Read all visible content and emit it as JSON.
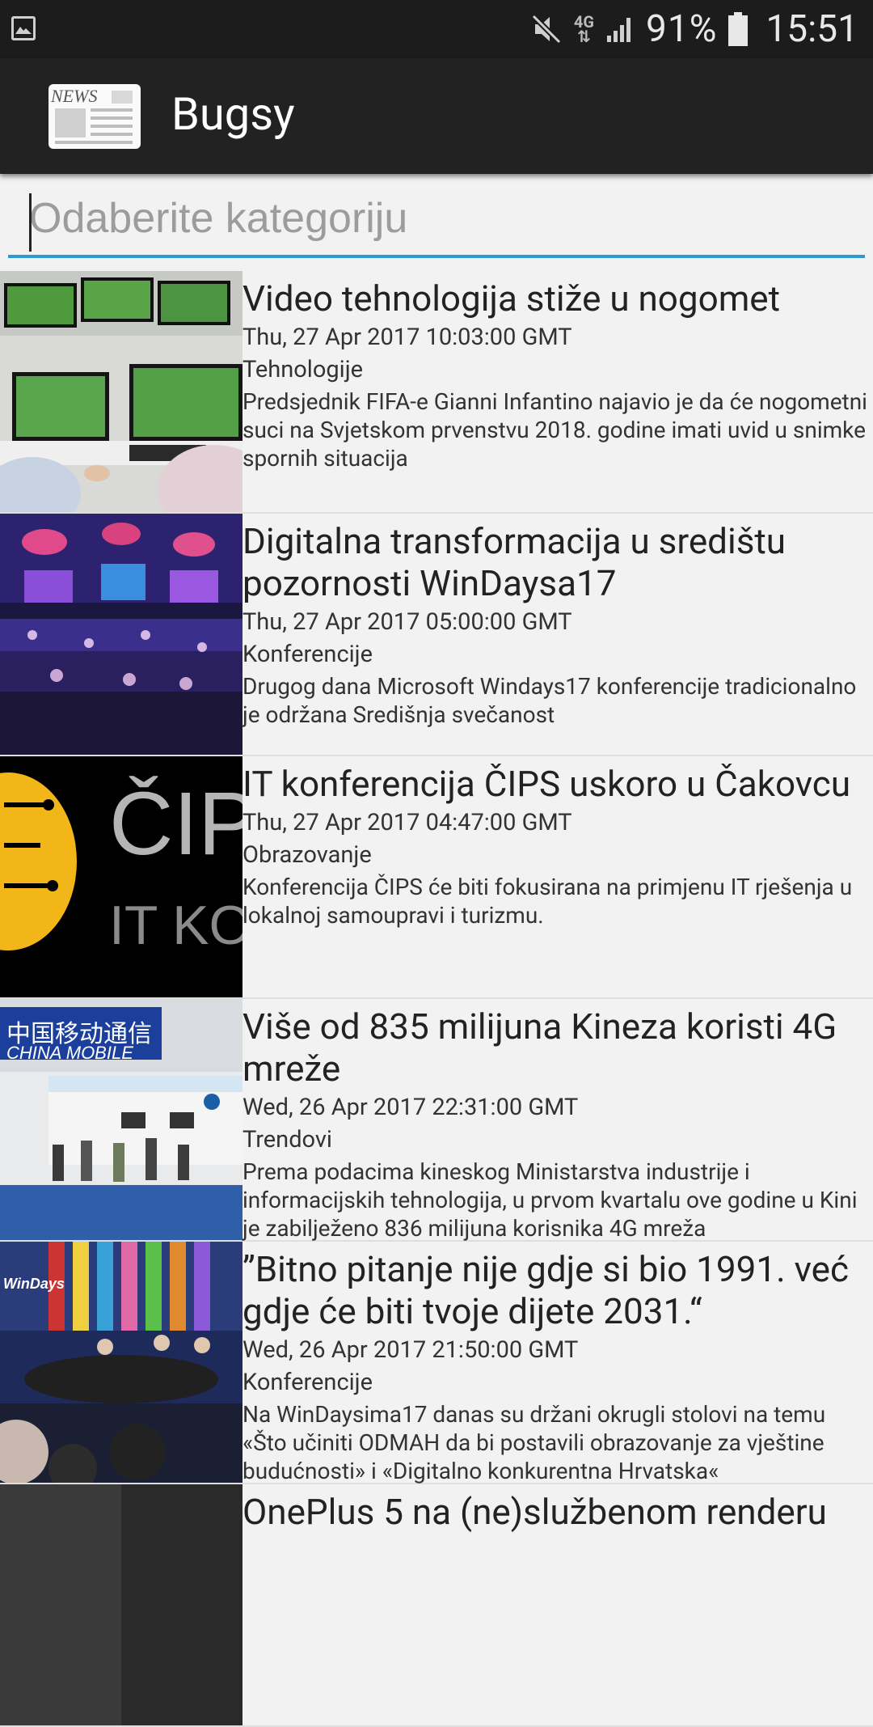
{
  "status_bar": {
    "battery_percent": "91%",
    "time": "15:51",
    "network": "4G",
    "icons": [
      "gallery-icon",
      "mute-icon",
      "network-4g-icon",
      "signal-icon",
      "battery-icon"
    ]
  },
  "app_bar": {
    "title": "Bugsy",
    "logo_text": "NEWS"
  },
  "search": {
    "placeholder": "Odaberite kategoriju"
  },
  "colors": {
    "accent": "#2d9ad3",
    "app_bar": "#222222",
    "status_bar": "#1c1c1c"
  },
  "articles": [
    {
      "title": "Video tehnologija stiže u nogomet",
      "date": "Thu, 27 Apr 2017 10:03:00 GMT",
      "category": "Tehnologije",
      "description": " Predsjednik FIFA-e Gianni Infantino najavio je da će nogometni suci na Svjetskom prvenstvu 2018. godine imati uvid u snimke spornih situacija"
    },
    {
      "title": "Digitalna transformacija u središtu pozornosti WinDaysa17",
      "date": "Thu, 27 Apr 2017 05:00:00 GMT",
      "category": "Konferencije",
      "description": " Drugog dana Microsoft Windays17 konferencije tradicionalno je održana Središnja svečanost"
    },
    {
      "title": "IT konferencija ČIPS uskoro u Čakovcu",
      "date": "Thu, 27 Apr 2017 04:47:00 GMT",
      "category": "Obrazovanje",
      "description": " Konferencija ČIPS će biti fokusirana na primjenu IT rješenja u lokalnoj samoupravi i turizmu.",
      "thumb_text": [
        "ČIPS",
        "IT KON"
      ]
    },
    {
      "title": "Više od 835 milijuna Kineza koristi 4G mreže",
      "date": "Wed, 26 Apr 2017 22:31:00 GMT",
      "category": "Trendovi",
      "description": " Prema podacima kineskog Ministarstva industrije i informacijskih tehnologija, u prvom kvartalu ove godine u Kini je zabilježeno 836 milijuna korisnika 4G mreža",
      "thumb_text": [
        "中国移动通信",
        "CHINA MOBILE"
      ]
    },
    {
      "title": "”Bitno pitanje nije gdje si bio 1991. već gdje će biti tvoje dijete 2031.“",
      "date": "Wed, 26 Apr 2017 21:50:00 GMT",
      "category": "Konferencije",
      "description": " Na WinDaysima17 danas su držani okrugli stolovi na temu «Što učiniti ODMAH da bi postavili obrazovanje za vještine budućnosti» i «Digitalno konkurentna Hrvatska«",
      "thumb_text": [
        "WinDays"
      ]
    },
    {
      "title": "OnePlus 5 na (ne)službenom renderu",
      "date": "",
      "category": "",
      "description": ""
    }
  ]
}
